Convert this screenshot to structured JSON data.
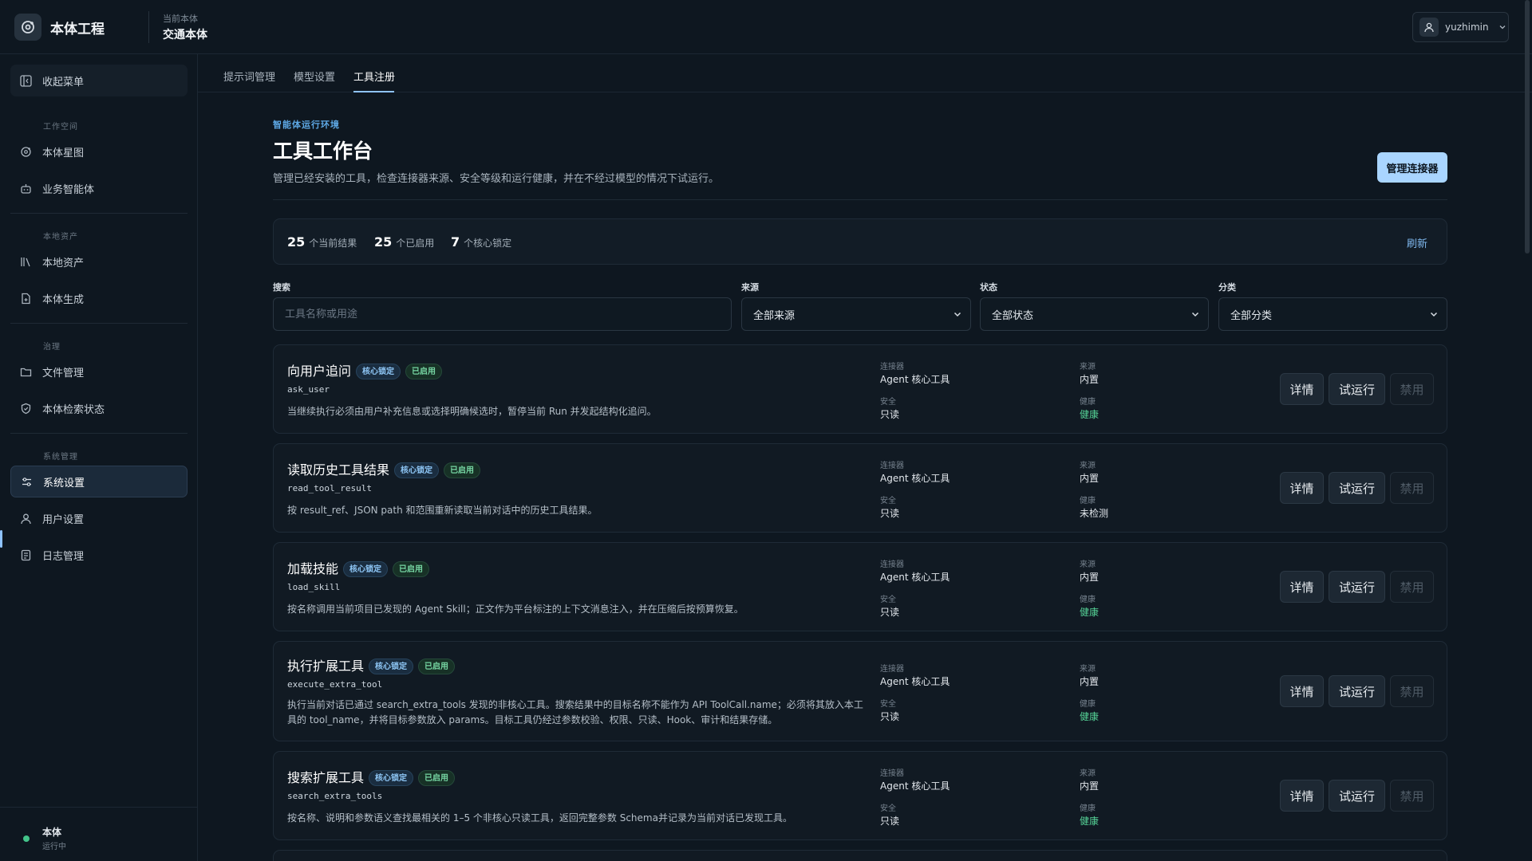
{
  "app": {
    "name": "本体工程",
    "current_label": "当前本体",
    "current_value": "交通本体"
  },
  "user": {
    "name": "yuzhimin"
  },
  "sidebar": {
    "collapse_label": "收起菜单",
    "sections": {
      "workspace": "工作空间",
      "local_assets": "本地资产",
      "governance": "治理",
      "system": "系统管理"
    },
    "items": [
      {
        "label": "本体星图",
        "icon": "ontology-icon"
      },
      {
        "label": "业务智能体",
        "icon": "robot-icon"
      },
      {
        "label": "本地资产",
        "icon": "library-icon"
      },
      {
        "label": "本体生成",
        "icon": "file-plus-icon"
      },
      {
        "label": "文件管理",
        "icon": "folder-icon"
      },
      {
        "label": "本体检索状态",
        "icon": "shield-icon"
      },
      {
        "label": "系统设置",
        "icon": "sliders-icon"
      },
      {
        "label": "用户设置",
        "icon": "user-icon"
      },
      {
        "label": "日志管理",
        "icon": "log-icon"
      }
    ],
    "status": {
      "title": "本体",
      "subtitle": "运行中"
    }
  },
  "tabs": [
    "提示词管理",
    "模型设置",
    "工具注册"
  ],
  "header": {
    "eyebrow": "智能体运行环境",
    "title": "工具工作台",
    "description": "管理已经安装的工具，检查连接器来源、安全等级和运行健康，并在不经过模型的情况下试运行。",
    "manage_button": "管理连接器"
  },
  "stats": {
    "current_count": "25",
    "current_label": "个当前结果",
    "enabled_count": "25",
    "enabled_label": "个已启用",
    "locked_count": "7",
    "locked_label": "个核心锁定",
    "refresh": "刷新"
  },
  "filters": {
    "search_label": "搜索",
    "search_placeholder": "工具名称或用途",
    "source_label": "来源",
    "source_value": "全部来源",
    "status_label": "状态",
    "status_value": "全部状态",
    "category_label": "分类",
    "category_value": "全部分类"
  },
  "meta_labels": {
    "connector": "连接器",
    "source": "来源",
    "security": "安全",
    "health": "健康"
  },
  "badges": {
    "core": "核心锁定",
    "enabled": "已启用"
  },
  "actions": {
    "details": "详情",
    "try_run": "试运行",
    "disable": "禁用"
  },
  "tools": [
    {
      "name": "向用户追问",
      "code": "ask_user",
      "description": "当继续执行必须由用户补充信息或选择明确候选时，暂停当前 Run 并发起结构化追问。",
      "connector": "Agent 核心工具",
      "source": "内置",
      "security": "只读",
      "health": "健康"
    },
    {
      "name": "读取历史工具结果",
      "code": "read_tool_result",
      "description": "按 result_ref、JSON path 和范围重新读取当前对话中的历史工具结果。",
      "connector": "Agent 核心工具",
      "source": "内置",
      "security": "只读",
      "health": "未检测"
    },
    {
      "name": "加载技能",
      "code": "load_skill",
      "description": "按名称调用当前项目已发现的 Agent Skill；正文作为平台标注的上下文消息注入，并在压缩后按预算恢复。",
      "connector": "Agent 核心工具",
      "source": "内置",
      "security": "只读",
      "health": "健康"
    },
    {
      "name": "执行扩展工具",
      "code": "execute_extra_tool",
      "description": "执行当前对话已通过 search_extra_tools 发现的非核心工具。搜索结果中的目标名称不能作为 API ToolCall.name；必须将其放入本工具的 tool_name，并将目标参数放入 params。目标工具仍经过参数校验、权限、只读、Hook、审计和结果存储。",
      "connector": "Agent 核心工具",
      "source": "内置",
      "security": "只读",
      "health": "健康"
    },
    {
      "name": "搜索扩展工具",
      "code": "search_extra_tools",
      "description": "按名称、说明和参数语义查找最相关的 1–5 个非核心只读工具，返回完整参数 Schema并记录为当前对话已发现工具。",
      "connector": "Agent 核心工具",
      "source": "内置",
      "security": "只读",
      "health": "健康"
    }
  ],
  "colors": {
    "accent": "#8fc3ff",
    "healthy": "#55d296",
    "primary_button": "#a9d5ff"
  }
}
